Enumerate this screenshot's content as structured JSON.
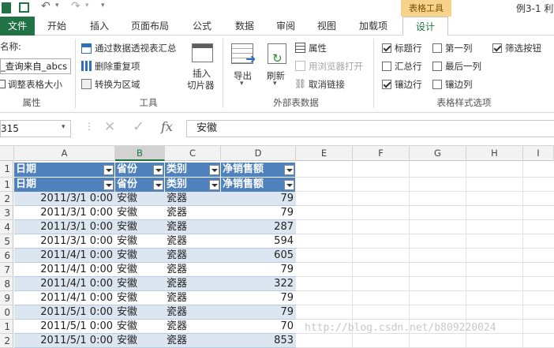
{
  "titlebar": {
    "contextual_tab": "表格工具",
    "title": "例3-1 利"
  },
  "tabs": [
    "文件",
    "开始",
    "插入",
    "页面布局",
    "公式",
    "数据",
    "审阅",
    "视图",
    "加载项",
    "设计"
  ],
  "ribbon": {
    "properties": {
      "name_label": "名称:",
      "table_name": "_查询来自_abcs",
      "resize_label": "调整表格大小",
      "group": "属性"
    },
    "tools": {
      "pivot": "通过数据透视表汇总",
      "remove_dup": "删除重复项",
      "convert_range": "转换为区域",
      "slicer_l1": "插入",
      "slicer_l2": "切片器",
      "group": "工具"
    },
    "external": {
      "export": "导出",
      "refresh": "刷新",
      "properties": "属性",
      "open_browser": "用浏览器打开",
      "unlink": "取消链接",
      "group": "外部表数据"
    },
    "style_options": {
      "header_row": "标题行",
      "first_column": "第一列",
      "filter_button": "筛选按钮",
      "total_row": "汇总行",
      "last_column": "最后一列",
      "banded_rows": "镶边行",
      "banded_columns": "镶边列",
      "checked": {
        "header_row": true,
        "first_column": false,
        "filter_button": true,
        "total_row": false,
        "last_column": false,
        "banded_rows": true,
        "banded_columns": false
      },
      "group": "表格样式选项"
    }
  },
  "formula_bar": {
    "name_box": "315",
    "cancel": "✕",
    "enter": "✓",
    "fx": "fx",
    "value": "安徽"
  },
  "columns": [
    "A",
    "B",
    "C",
    "D",
    "E",
    "F",
    "G",
    "H",
    "I"
  ],
  "table": {
    "headers": [
      "日期",
      "省份",
      "类别",
      "净销售额"
    ],
    "row_numbers": [
      "1",
      "1",
      "2",
      "3",
      "4",
      "5",
      "6",
      "7",
      "8",
      "9",
      "0",
      "1",
      "2"
    ],
    "rows": [
      [
        "2011/3/1  0:00",
        "安徽",
        "瓷器",
        "79"
      ],
      [
        "2011/3/1  0:00",
        "安徽",
        "瓷器",
        "79"
      ],
      [
        "2011/3/1  0:00",
        "安徽",
        "瓷器",
        "287"
      ],
      [
        "2011/3/1  0:00",
        "安徽",
        "瓷器",
        "594"
      ],
      [
        "2011/4/1  0:00",
        "安徽",
        "瓷器",
        "605"
      ],
      [
        "2011/4/1  0:00",
        "安徽",
        "瓷器",
        "79"
      ],
      [
        "2011/4/1  0:00",
        "安徽",
        "瓷器",
        "322"
      ],
      [
        "2011/4/1  0:00",
        "安徽",
        "瓷器",
        "79"
      ],
      [
        "2011/5/1  0:00",
        "安徽",
        "瓷器",
        "79"
      ],
      [
        "2011/5/1  0:00",
        "安徽",
        "瓷器",
        "70"
      ],
      [
        "2011/5/1  0:00",
        "安徽",
        "瓷器",
        "853"
      ]
    ]
  },
  "watermark": "http://blog.csdn.net/b809220024",
  "colors": {
    "excel_green": "#217346",
    "table_header": "#4f81bd",
    "band": "#dce6f1",
    "context_tab": "#f7d28b"
  }
}
